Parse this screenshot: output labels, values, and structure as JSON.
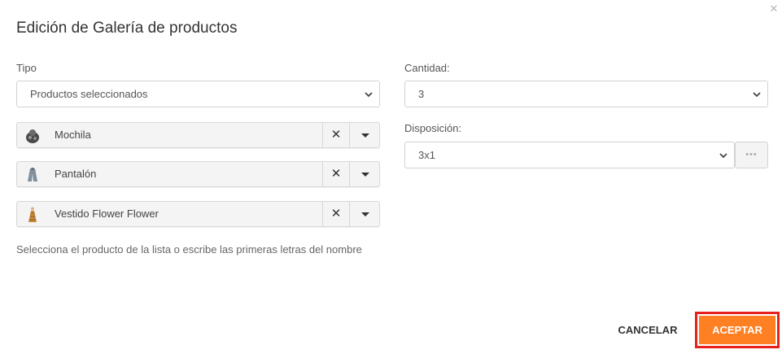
{
  "dialog": {
    "title": "Edición de Galería de productos",
    "close_icon": "close-icon"
  },
  "tipo": {
    "label": "Tipo",
    "selected": "Productos seleccionados"
  },
  "products": [
    {
      "name": "Mochila",
      "icon": "backpack-thumbnail"
    },
    {
      "name": "Pantalón",
      "icon": "coat-thumbnail"
    },
    {
      "name": "Vestido Flower Flower",
      "icon": "dress-thumbnail"
    }
  ],
  "help_text": "Selecciona el producto de la lista o escribe las primeras letras del nombre",
  "cantidad": {
    "label": "Cantidad:",
    "selected": "3"
  },
  "disposicion": {
    "label": "Disposición:",
    "selected": "3x1",
    "options_icon": "ellipsis-icon"
  },
  "actions": {
    "cancel_label": "CANCELAR",
    "accept_label": "ACEPTAR"
  },
  "colors": {
    "accent": "#ff7f23",
    "highlight": "#e8201c"
  }
}
